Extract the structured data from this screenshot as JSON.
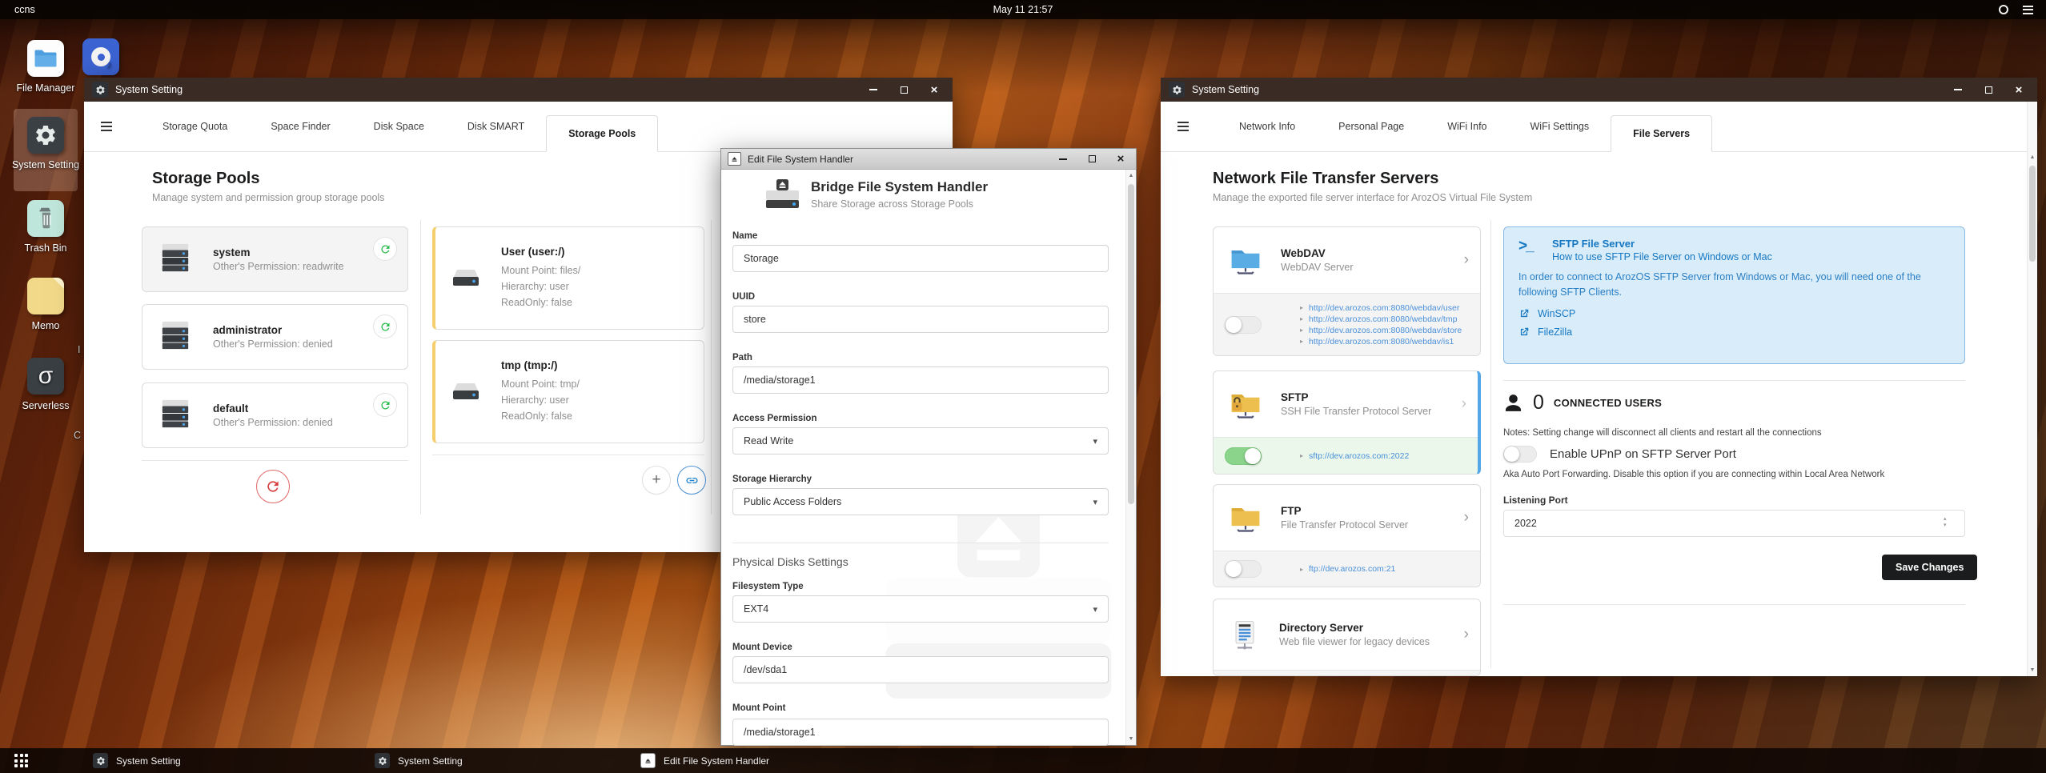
{
  "topbar": {
    "host": "ccns",
    "clock": "May 11 21:57"
  },
  "desktop": {
    "icons": [
      {
        "label": "File Manager"
      },
      {
        "label": "System Setting"
      },
      {
        "label": "Trash Bin"
      },
      {
        "label": "Memo"
      },
      {
        "label": "Serverless"
      }
    ],
    "peek_labels": {
      "a": "I",
      "b": "C"
    }
  },
  "storage_window": {
    "title": "System Setting",
    "tabs": [
      {
        "label": "Storage Quota"
      },
      {
        "label": "Space Finder"
      },
      {
        "label": "Disk Space"
      },
      {
        "label": "Disk SMART"
      },
      {
        "label": "Storage Pools"
      }
    ],
    "heading": "Storage Pools",
    "subheading": "Manage system and permission group storage pools",
    "pools": [
      {
        "name": "system",
        "info": "Other's Permission: readwrite"
      },
      {
        "name": "administrator",
        "info": "Other's Permission: denied"
      },
      {
        "name": "default",
        "info": "Other's Permission: denied"
      }
    ],
    "mounts": [
      {
        "name": "User (user:/)",
        "line1": "Mount Point: files/",
        "line2": "Hierarchy: user",
        "line3": "ReadOnly: false"
      },
      {
        "name": "tmp (tmp:/)",
        "line1": "Mount Point: tmp/",
        "line2": "Hierarchy: user",
        "line3": "ReadOnly: false"
      }
    ]
  },
  "edit_window": {
    "title": "Edit File System Handler",
    "header": {
      "title": "Bridge File System Handler",
      "subtitle": "Share Storage across Storage Pools"
    },
    "fields": {
      "name_label": "Name",
      "name_value": "Storage",
      "uuid_label": "UUID",
      "uuid_value": "store",
      "path_label": "Path",
      "path_value": "/media/storage1",
      "access_label": "Access Permission",
      "access_value": "Read Write",
      "hierarchy_label": "Storage Hierarchy",
      "hierarchy_value": "Public Access Folders",
      "section_label": "Physical Disks Settings",
      "fstype_label": "Filesystem Type",
      "fstype_value": "EXT4",
      "mount_device_label": "Mount Device",
      "mount_device_value": "/dev/sda1",
      "mount_point_label": "Mount Point",
      "mount_point_value": "/media/storage1"
    }
  },
  "network_window": {
    "title": "System Setting",
    "tabs": [
      {
        "label": "Network Info"
      },
      {
        "label": "Personal Page"
      },
      {
        "label": "WiFi Info"
      },
      {
        "label": "WiFi Settings"
      },
      {
        "label": "File Servers"
      }
    ],
    "heading": "Network File Transfer Servers",
    "subheading": "Manage the exported file server interface for ArozOS Virtual File System",
    "servers": [
      {
        "name": "WebDAV",
        "desc": "WebDAV Server",
        "enabled": false,
        "links": [
          "http://dev.arozos.com:8080/webdav/user",
          "http://dev.arozos.com:8080/webdav/tmp",
          "http://dev.arozos.com:8080/webdav/store",
          "http://dev.arozos.com:8080/webdav/is1"
        ]
      },
      {
        "name": "SFTP",
        "desc": "SSH File Transfer Protocol Server",
        "enabled": true,
        "links": [
          "sftp://dev.arozos.com:2022"
        ]
      },
      {
        "name": "FTP",
        "desc": "File Transfer Protocol Server",
        "enabled": false,
        "links": [
          "ftp://dev.arozos.com:21"
        ]
      },
      {
        "name": "Directory Server",
        "desc": "Web file viewer for legacy devices"
      }
    ],
    "sftp_panel": {
      "title": "SFTP File Server",
      "subtitle": "How to use SFTP File Server on Windows or Mac",
      "body": "In order to connect to ArozOS SFTP Server from Windows or Mac, you will need one of the following SFTP Clients.",
      "clients": [
        {
          "label": "WinSCP"
        },
        {
          "label": "FileZilla"
        }
      ]
    },
    "connected": {
      "count": "0",
      "label": "CONNECTED USERS"
    },
    "notes": "Notes: Setting change will disconnect all clients and restart all the connections",
    "upnp": {
      "label": "Enable UPnP on SFTP Server Port",
      "hint": "Aka Auto Port Forwarding. Disable this option if you are connecting within Local Area Network"
    },
    "port": {
      "label": "Listening Port",
      "value": "2022"
    },
    "save_label": "Save Changes"
  },
  "taskbar": {
    "items": [
      {
        "label": "System Setting"
      },
      {
        "label": "System Setting"
      },
      {
        "label": "Edit File System Handler"
      }
    ]
  },
  "colors": {
    "accent_blue": "#4a90d9",
    "link_blue": "#1678c2",
    "toggle_green": "#8bd48b",
    "refresh_green": "#21ba45",
    "refresh_red": "#d83c3c",
    "card_yellow_border": "#f5cf6e",
    "sftp_border_blue": "#55a8e8",
    "panel_blue_bg": "#d8ecfa",
    "save_black": "#1b1c1d"
  }
}
